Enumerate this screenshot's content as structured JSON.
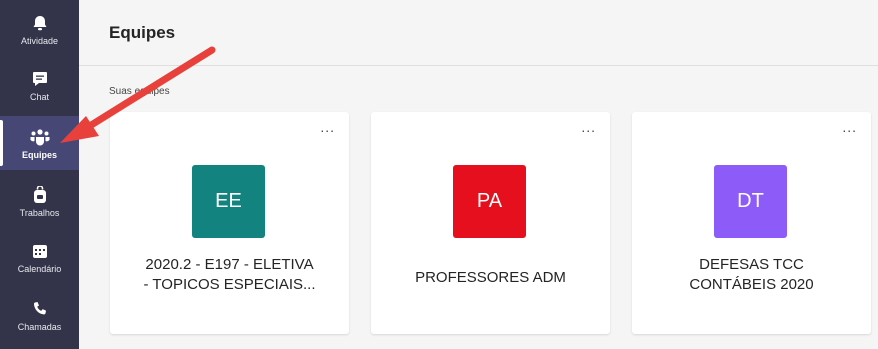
{
  "rail": {
    "items": [
      {
        "label": "Atividade",
        "icon": "bell-icon"
      },
      {
        "label": "Chat",
        "icon": "chat-icon"
      },
      {
        "label": "Equipes",
        "icon": "teams-icon",
        "active": true
      },
      {
        "label": "Trabalhos",
        "icon": "backpack-icon"
      },
      {
        "label": "Calendário",
        "icon": "calendar-icon"
      },
      {
        "label": "Chamadas",
        "icon": "phone-icon"
      }
    ]
  },
  "header": {
    "title": "Equipes"
  },
  "section": {
    "label": "Suas equipes"
  },
  "teams": [
    {
      "initials": "EE",
      "color": "#138380",
      "name_line1": "2020.2 - E197 - ELETIVA",
      "name_line2": "- TOPICOS ESPECIAIS...",
      "more": "..."
    },
    {
      "initials": "PA",
      "color": "#e60f1d",
      "name_line1": "PROFESSORES ADM",
      "name_line2": "",
      "more": "..."
    },
    {
      "initials": "DT",
      "color": "#8d5cf8",
      "name_line1": "DEFESAS TCC",
      "name_line2": "CONTÁBEIS 2020",
      "more": "..."
    }
  ],
  "annotation": {
    "arrow_color": "#e8413c"
  }
}
